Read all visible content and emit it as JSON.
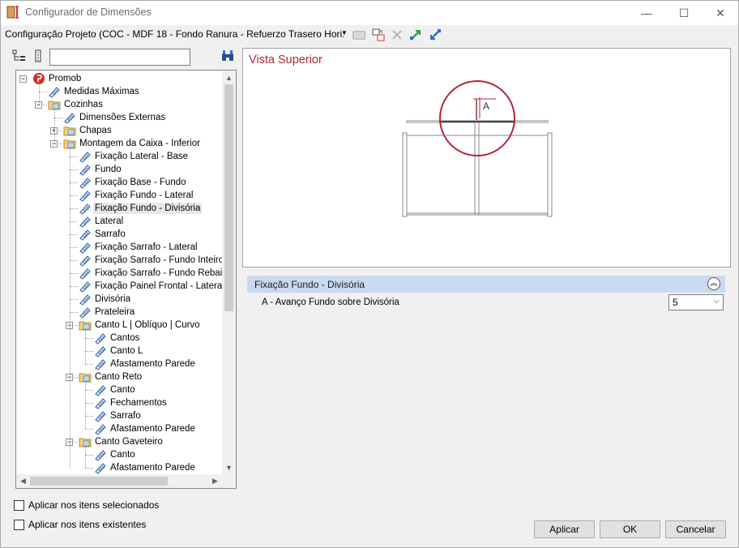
{
  "window": {
    "title": "Configurador de Dimensões",
    "minimize": "—",
    "maximize": "☐",
    "close": "✕"
  },
  "toolbar": {
    "configuration": "Configuração Projeto (COC - MDF 18 - Fondo Ranura - Refuerzo Trasero Hori:",
    "dropdown_icon": "chevron-down-icon",
    "icons": [
      "properties-icon",
      "copy-delete-icon",
      "delete-icon",
      "expand-green-arrow-icon",
      "collapse-blue-arrow-icon"
    ]
  },
  "tree": {
    "search": {
      "value": "",
      "placeholder": ""
    },
    "items": [
      {
        "label": "Promob",
        "icon": "promob-logo-icon",
        "level": 0,
        "expander": "−"
      },
      {
        "label": "Medidas Máximas",
        "icon": "tape-icon",
        "level": 1
      },
      {
        "label": "Cozinhas",
        "icon": "folder-icon",
        "level": 1,
        "expander": "−"
      },
      {
        "label": "Dimensões Externas",
        "icon": "tape-icon",
        "level": 2
      },
      {
        "label": "Chapas",
        "icon": "folder-icon",
        "level": 2,
        "expander": "+"
      },
      {
        "label": "Montagem da Caixa - Inferior",
        "icon": "folder-icon",
        "level": 2,
        "expander": "−"
      },
      {
        "label": "Fixação Lateral - Base",
        "icon": "tape-icon",
        "level": 3
      },
      {
        "label": "Fundo",
        "icon": "tape-icon",
        "level": 3
      },
      {
        "label": "Fixação Base - Fundo",
        "icon": "tape-icon",
        "level": 3
      },
      {
        "label": "Fixação Fundo - Lateral",
        "icon": "tape-icon",
        "level": 3
      },
      {
        "label": "Fixação Fundo - Divisória",
        "icon": "tape-icon",
        "level": 3,
        "selected": true
      },
      {
        "label": "Lateral",
        "icon": "tape-icon",
        "level": 3
      },
      {
        "label": "Sarrafo",
        "icon": "tape-icon",
        "level": 3
      },
      {
        "label": "Fixação Sarrafo - Lateral",
        "icon": "tape-icon",
        "level": 3
      },
      {
        "label": "Fixação Sarrafo - Fundo Inteiro",
        "icon": "tape-icon",
        "level": 3
      },
      {
        "label": "Fixação Sarrafo - Fundo Rebaixa",
        "icon": "tape-icon",
        "level": 3
      },
      {
        "label": "Fixação Painel Frontal - Lateral",
        "icon": "tape-icon",
        "level": 3
      },
      {
        "label": "Divisória",
        "icon": "tape-icon",
        "level": 3
      },
      {
        "label": "Prateleira",
        "icon": "tape-icon",
        "level": 3
      },
      {
        "label": "Canto L | Oblíquo | Curvo",
        "icon": "folder-icon",
        "level": 3,
        "expander": "−"
      },
      {
        "label": "Cantos",
        "icon": "tape-icon",
        "level": 4
      },
      {
        "label": "Canto L",
        "icon": "tape-icon",
        "level": 4
      },
      {
        "label": "Afastamento Parede",
        "icon": "tape-icon",
        "level": 4
      },
      {
        "label": "Canto Reto",
        "icon": "folder-icon",
        "level": 3,
        "expander": "−"
      },
      {
        "label": "Canto",
        "icon": "tape-icon",
        "level": 4
      },
      {
        "label": "Fechamentos",
        "icon": "tape-icon",
        "level": 4
      },
      {
        "label": "Sarrafo",
        "icon": "tape-icon",
        "level": 4
      },
      {
        "label": "Afastamento Parede",
        "icon": "tape-icon",
        "level": 4
      },
      {
        "label": "Canto Gaveteiro",
        "icon": "folder-icon",
        "level": 3,
        "expander": "−"
      },
      {
        "label": "Canto",
        "icon": "tape-icon",
        "level": 4
      },
      {
        "label": "Afastamento Parede",
        "icon": "tape-icon",
        "level": 4
      }
    ]
  },
  "preview": {
    "title": "Vista Superior",
    "dimension_label": "A",
    "accent_color": "#b0263a"
  },
  "properties": {
    "group_title": "Fixação Fundo - Divisória",
    "rows": [
      {
        "label": "A - Avanço Fundo sobre Divisória",
        "value": "5"
      }
    ]
  },
  "options": {
    "apply_selected": "Aplicar nos itens selecionados",
    "apply_existing": "Aplicar nos itens existentes"
  },
  "buttons": {
    "apply": "Aplicar",
    "ok": "OK",
    "cancel": "Cancelar"
  }
}
